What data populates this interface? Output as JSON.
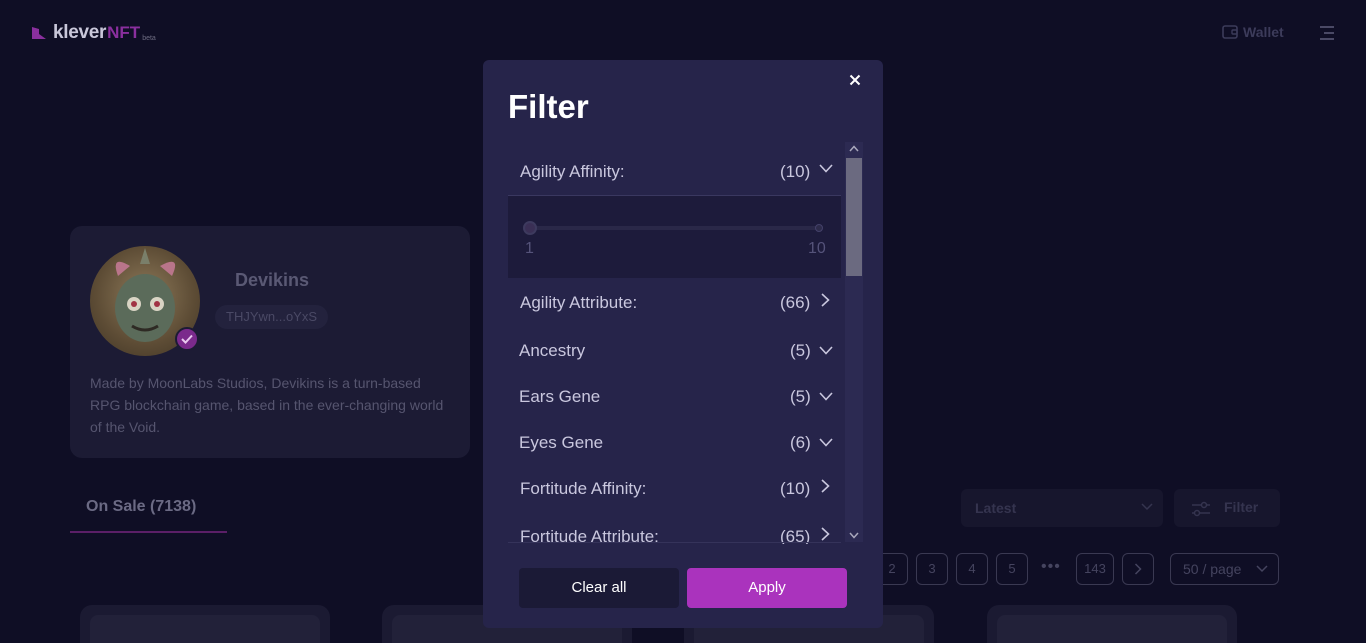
{
  "header": {
    "logo_text": "klever",
    "logo_nft": "NFT",
    "logo_beta": "beta",
    "wallet_label": "Wallet"
  },
  "profile": {
    "name": "Devikins",
    "address": "THJYwn...oYxS",
    "description": "Made by MoonLabs Studios, Devikins is a turn-based RPG blockchain game, based in the ever-changing world of the Void."
  },
  "tabs": {
    "on_sale": "On Sale (7138)"
  },
  "controls": {
    "sort_value": "Latest",
    "filter_label": "Filter"
  },
  "pagination": {
    "pages": [
      "2",
      "3",
      "4",
      "5"
    ],
    "dots": "•••",
    "last_page": "143",
    "per_page": "50 / page"
  },
  "modal": {
    "title": "Filter",
    "range": {
      "min": "1",
      "max": "10"
    },
    "filters": [
      {
        "label": "Agility Affinity:",
        "count": "(10)",
        "state": "expanded"
      },
      {
        "label": "Agility Attribute:",
        "count": "(66)",
        "state": "collapsed"
      },
      {
        "label": "Ancestry",
        "count": "(5)",
        "state": "expandable"
      },
      {
        "label": "Ears Gene",
        "count": "(5)",
        "state": "expandable"
      },
      {
        "label": "Eyes Gene",
        "count": "(6)",
        "state": "expandable"
      },
      {
        "label": "Fortitude Affinity:",
        "count": "(10)",
        "state": "collapsed"
      },
      {
        "label": "Fortitude Attribute:",
        "count": "(65)",
        "state": "collapsed"
      }
    ],
    "clear_label": "Clear all",
    "apply_label": "Apply"
  },
  "colors": {
    "accent": "#aa33bd",
    "modal_bg": "#26244a",
    "page_bg": "#0f0e25"
  }
}
